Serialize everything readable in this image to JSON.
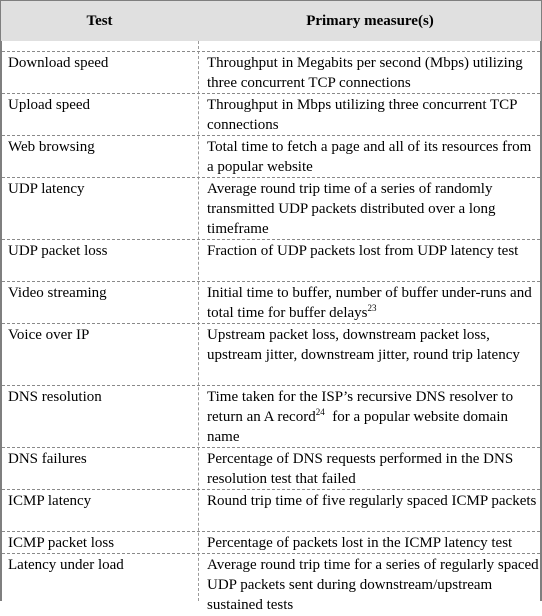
{
  "table": {
    "headers": {
      "test": "Test",
      "measure": "Primary measure(s)"
    },
    "rows": [
      {
        "test": "Download speed",
        "measure": "Throughput in Megabits per second (Mbps) utilizing three concurrent TCP connections",
        "footnote": ""
      },
      {
        "test": "Upload speed",
        "measure": "Throughput in Mbps utilizing three concurrent TCP connections",
        "footnote": ""
      },
      {
        "test": "Web browsing",
        "measure": "Total time to fetch a page and all of its resources from a popular website",
        "footnote": ""
      },
      {
        "test": "UDP latency",
        "measure": "Average round trip time of a series of randomly transmitted UDP packets distributed over a long timeframe",
        "footnote": ""
      },
      {
        "test": "UDP packet loss",
        "measure": "Fraction of UDP packets lost from UDP latency test",
        "footnote": ""
      },
      {
        "test": "Video streaming",
        "measure": "Initial time to buffer, number of buffer under-runs and total time for buffer delays",
        "footnote": "23"
      },
      {
        "test": "Voice over IP",
        "measure": "Upstream packet loss, downstream packet loss, upstream jitter, downstream jitter, round trip latency",
        "footnote": ""
      },
      {
        "test": "DNS resolution",
        "measure_pre": "Time taken for the ISP’s recursive DNS resolver to return an A record",
        "footnote": "24",
        "measure_post": "  for a popular website domain name"
      },
      {
        "test": "DNS failures",
        "measure": "Percentage of DNS requests performed in the DNS resolution test that failed",
        "footnote": ""
      },
      {
        "test": "ICMP latency",
        "measure": "Round trip time of five regularly spaced ICMP packets",
        "footnote": ""
      },
      {
        "test": "ICMP packet loss",
        "measure": "Percentage of packets lost in the ICMP latency test",
        "footnote": ""
      },
      {
        "test": "Latency under load",
        "measure": "Average round trip time for a series of regularly spaced UDP packets sent during downstream/upstream sustained tests",
        "footnote": ""
      }
    ]
  }
}
